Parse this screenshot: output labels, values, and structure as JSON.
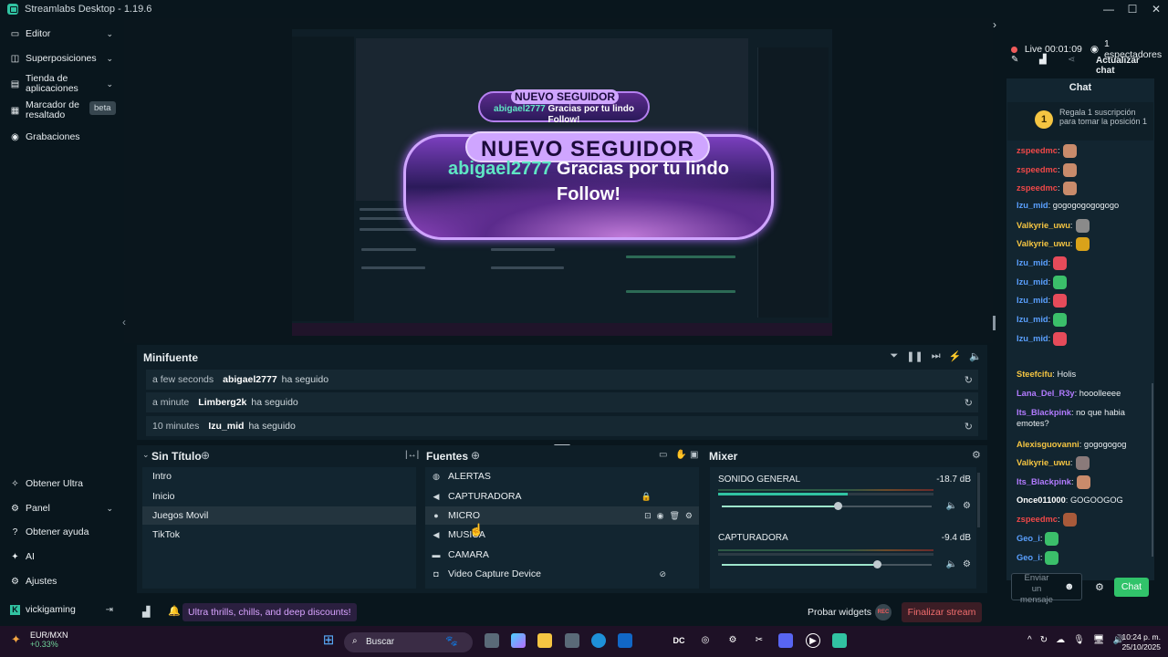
{
  "window": {
    "title": "Streamlabs Desktop - 1.19.6"
  },
  "nav": {
    "items": [
      {
        "label": "Editor"
      },
      {
        "label": "Superposiciones"
      },
      {
        "label": "Tienda de\naplicaciones"
      },
      {
        "label": "Marcador de\nresaltado",
        "badge": "beta"
      },
      {
        "label": "Grabaciones"
      }
    ],
    "bottom": [
      {
        "label": "Obtener Ultra"
      },
      {
        "label": "Panel"
      },
      {
        "label": "Obtener ayuda"
      },
      {
        "label": "AI"
      },
      {
        "label": "Ajustes"
      }
    ],
    "user": "vickigaming"
  },
  "preview": {
    "alert_title": "NUEVO SEGUIDOR",
    "alert_user": "abigael2777",
    "alert_msg1": " Gracias por tu lindo",
    "alert_msg2": "Follow!"
  },
  "minifuente": {
    "title": "Minifuente",
    "events": [
      {
        "time": "a few seconds",
        "user": "abigael2777",
        "action": "ha seguido"
      },
      {
        "time": "a minute",
        "user": "Limberg2k",
        "action": "ha seguido"
      },
      {
        "time": "10 minutes",
        "user": "Izu_mid",
        "action": "ha seguido"
      }
    ]
  },
  "scenes": {
    "title": "Sin Título",
    "items": [
      "Intro",
      "Inicio",
      "Juegos Movil",
      "TikTok"
    ],
    "selected": 2
  },
  "sources": {
    "title": "Fuentes",
    "items": [
      "ALERTAS",
      "CAPTURADORA",
      "MICRO",
      "MUSICA",
      "CAMARA",
      "Video Capture Device"
    ],
    "selected": 2
  },
  "mixer": {
    "title": "Mixer",
    "tracks": [
      {
        "name": "SONIDO GENERAL",
        "db": "-18.7 dB",
        "volume": 0.55,
        "level": 0.6
      },
      {
        "name": "CAPTURADORA",
        "db": "-9.4 dB",
        "volume": 0.74,
        "level": 0.0
      }
    ]
  },
  "statusbar": {
    "promo": "Ultra thrills, chills, and deep discounts!",
    "test_widgets": "Probar widgets",
    "rec": "REC",
    "end_stream": "Finalizar stream"
  },
  "stream": {
    "live_label": "Live",
    "uptime": "00:01:09",
    "viewers": "1 espectadores",
    "refresh_chat": "Actualizar chat"
  },
  "chat": {
    "title": "Chat",
    "promo_rank": "1",
    "promo_text": "Regala 1 suscripción para tomar la posición 1",
    "input_placeholder": "Enviar un mensaje",
    "send_label": "Chat",
    "messages": [
      {
        "user": "zspeedmc",
        "text": "",
        "color": "#f04848",
        "emote": "#c98b6b"
      },
      {
        "user": "zspeedmc",
        "text": "",
        "color": "#f04848",
        "emote": "#c98b6b"
      },
      {
        "user": "zspeedmc",
        "text": "",
        "color": "#f04848",
        "emote": "#c98b6b"
      },
      {
        "user": "Izu_mid",
        "text": " gogogogogogogo",
        "color": "#5aa0ff",
        "emote": ""
      },
      {
        "user": "Valkyrie_uwu",
        "text": "",
        "color": "#f5c542",
        "emote": "#8a8a8a"
      },
      {
        "user": "Valkyrie_uwu",
        "text": "",
        "color": "#f5c542",
        "emote": "#d9a21a"
      },
      {
        "user": "Izu_mid",
        "text": "",
        "color": "#5aa0ff",
        "emote": "#e64b5a"
      },
      {
        "user": "Izu_mid",
        "text": "",
        "color": "#5aa0ff",
        "emote": "#3bbf6a"
      },
      {
        "user": "Izu_mid",
        "text": "",
        "color": "#5aa0ff",
        "emote": "#e64b5a"
      },
      {
        "user": "Izu_mid",
        "text": "",
        "color": "#5aa0ff",
        "emote": "#3bbf6a"
      },
      {
        "user": "Izu_mid",
        "text": "",
        "color": "#5aa0ff",
        "emote": "#e64b5a"
      },
      {
        "user": "Steefcifu",
        "text": " Holis",
        "color": "#f5c542",
        "emote": ""
      },
      {
        "user": "Lana_Del_R3y",
        "text": " hooolleeee",
        "color": "#b27bff",
        "emote": ""
      },
      {
        "user": "Its_Blackpink",
        "text": " no que habia emotes?",
        "color": "#b27bff",
        "emote": ""
      },
      {
        "user": "Alexisguovanni",
        "text": " gogogogog",
        "color": "#f5c542",
        "emote": ""
      },
      {
        "user": "Valkyrie_uwu",
        "text": "",
        "color": "#f5c542",
        "emote": "#8a7a7a"
      },
      {
        "user": "Its_Blackpink",
        "text": "",
        "color": "#b27bff",
        "emote": "#c98b6b"
      },
      {
        "user": "Once011000",
        "text": " GOGOOGOG",
        "color": "#ffffff",
        "emote": ""
      },
      {
        "user": "zspeedmc",
        "text": "",
        "color": "#f04848",
        "emote": "#a85a3a"
      },
      {
        "user": "Geo_i",
        "text": "",
        "color": "#5aa0ff",
        "emote": "#3bbf6a"
      },
      {
        "user": "Geo_i",
        "text": "",
        "color": "#5aa0ff",
        "emote": "#3bbf6a"
      }
    ]
  },
  "taskbar": {
    "ticker": "EUR/MXN",
    "change": "+0.33%",
    "search": "Buscar",
    "time": "10:24 p. m.",
    "date": "25/10/2025"
  }
}
